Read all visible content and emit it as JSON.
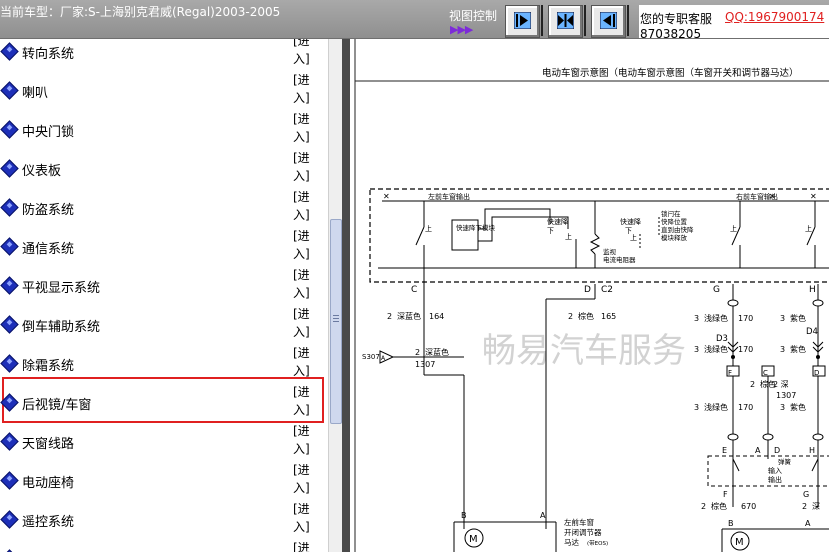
{
  "topbar": {
    "car_title": "当前车型：厂家:S-上海别克君威(Regal)2003-2005",
    "view_control_label": "视图控制",
    "view_control_arrows": "▶▶▶",
    "service_label": "您的专职客服",
    "qq": "QQ:1967900174",
    "phone": "87038205"
  },
  "sidebar": {
    "enter_label": "[进入]",
    "items": [
      {
        "label": "转向系统"
      },
      {
        "label": "喇叭"
      },
      {
        "label": "中央门锁"
      },
      {
        "label": "仪表板"
      },
      {
        "label": "防盗系统"
      },
      {
        "label": "通信系统"
      },
      {
        "label": "平视显示系统"
      },
      {
        "label": "倒车辅助系统"
      },
      {
        "label": "除霜系统"
      },
      {
        "label": "后视镜/车窗"
      },
      {
        "label": "天窗线路"
      },
      {
        "label": "电动座椅"
      },
      {
        "label": "遥控系统"
      },
      {
        "label": ""
      }
    ]
  },
  "diagram": {
    "title": "电动车窗示意图（电动车窗示意图（车窗开关和调节器马达）",
    "watermark": "畅易汽车服务",
    "labels": {
      "left_front_out": "左前车窗输出",
      "right_front_out": "右前车窗输出",
      "up1": "上",
      "up2": "上",
      "up3": "上",
      "down1": "下",
      "express_module": "快速降下模块",
      "express_down1": "快速降",
      "express_down2": "下",
      "express_down3": "快速降",
      "express_down4": "下",
      "lock1": "锁闩在",
      "lock2": "快降位置",
      "lock3": "直到由快降",
      "lock4": "模块释放",
      "monitor1": "监视",
      "monitor2": "电流电阻器",
      "pin_c": "C",
      "pin_d": "D",
      "pin_c2": "C2",
      "pin_g": "G",
      "pin_h": "H",
      "w164_gauge": "2",
      "w164_color": "深蓝色",
      "w164_num": "164",
      "w165_gauge": "2",
      "w165_color": "棕色",
      "w165_num": "165",
      "w170a_gauge": "3",
      "w170a_color": "浅绿色",
      "w170a_num": "170",
      "w_purple1_gauge": "3",
      "w_purple1_color": "紫色",
      "d3": "D3",
      "d4": "D4",
      "w170b_gauge": "3",
      "w170b_color": "浅绿色",
      "w170b_num": "170",
      "w_purple2_gauge": "3",
      "w_purple2_color": "紫色",
      "s307": "S307",
      "s307_pin": "A",
      "w1307a_gauge": "2",
      "w1307a_color": "深蓝色",
      "w1307a_num": "1307",
      "pin_f1": "F",
      "pin_c3": "C",
      "pin_d2": "D",
      "w_brown2_gauge": "2",
      "w_brown2_color": "棕色",
      "w1307b_num": "1307",
      "w_darkblue_deep": "2 深",
      "w_darkblue_blue": "蓝色",
      "w170c_gauge": "3",
      "w170c_color": "浅绿色",
      "w170c_num": "170",
      "w_purple3_gauge": "3",
      "w_purple3_color": "紫色",
      "pin_e": "E",
      "pin_a1": "A",
      "pin_d5": "D",
      "pin_h2": "H",
      "spring": "弹簧",
      "input": "输入",
      "output": "输出",
      "pin_f2": "F",
      "pin_g2": "G",
      "w670_gauge": "2",
      "w670_color": "棕色",
      "w670_num": "670",
      "w_deep2_gauge": "2",
      "w_deep2_color": "深",
      "pin_b1": "B",
      "pin_a2": "A",
      "pin_b2": "B",
      "pin_a3": "A",
      "motor": "M",
      "motor2": "M",
      "lf_window1": "左前车窗",
      "lf_window2": "开闭调节器",
      "lf_window3": "马达",
      "lf_window_note": "(带EOS)"
    }
  }
}
